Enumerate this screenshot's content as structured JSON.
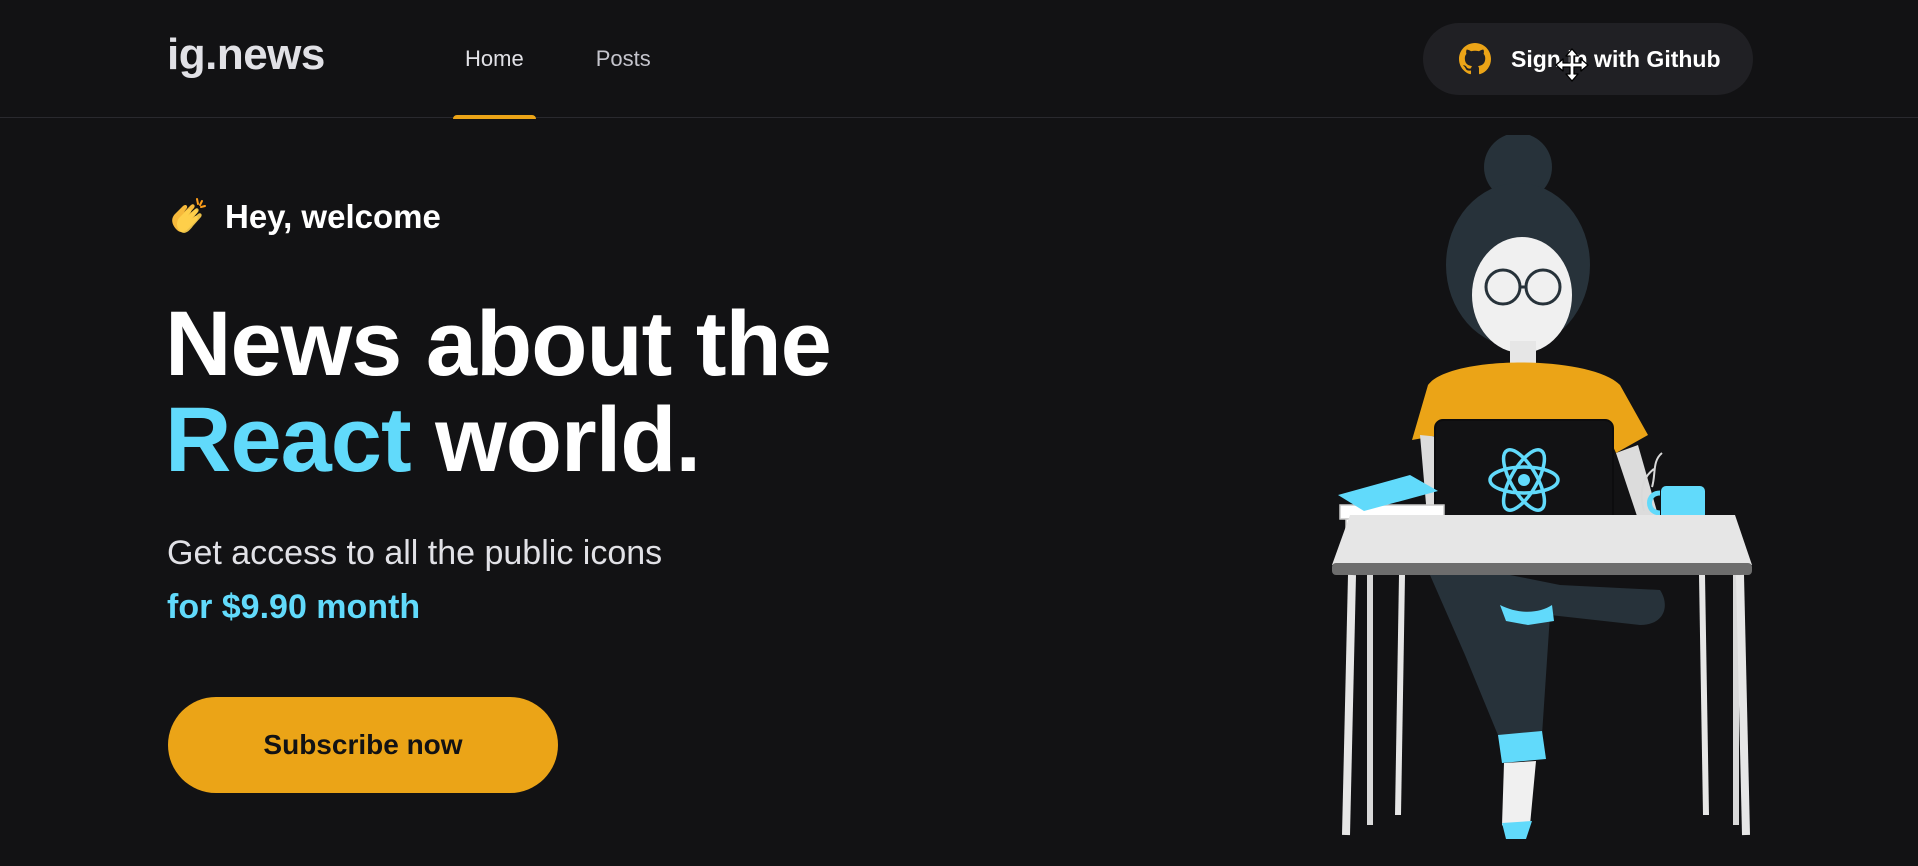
{
  "header": {
    "logo": "ig.news",
    "nav": [
      {
        "label": "Home",
        "active": true
      },
      {
        "label": "Posts",
        "active": false
      }
    ],
    "signin_label": "Sign in with Github",
    "signin_icon": "github-icon"
  },
  "hero": {
    "welcome_emoji": "clapping-hands-icon",
    "welcome": "Hey, welcome",
    "title_line1": "News about the",
    "title_accent": "React",
    "title_rest": "world.",
    "subtitle": "Get access to all the public icons",
    "price": "for $9.90 month",
    "cta": "Subscribe now"
  },
  "colors": {
    "background": "#121214",
    "accent_yellow": "#eba417",
    "accent_cyan": "#61dafb",
    "button_dark": "#202024"
  }
}
